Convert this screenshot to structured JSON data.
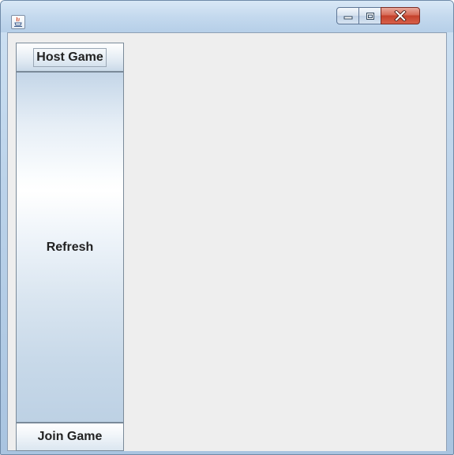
{
  "window": {
    "title": "",
    "icon": "java-cup-icon",
    "controls": {
      "minimize": "minimize-icon",
      "maximize": "maximize-icon",
      "close": "close-icon"
    }
  },
  "sidebar": {
    "host_game_label": "Host Game",
    "refresh_label": "Refresh",
    "join_game_label": "Join Game"
  }
}
